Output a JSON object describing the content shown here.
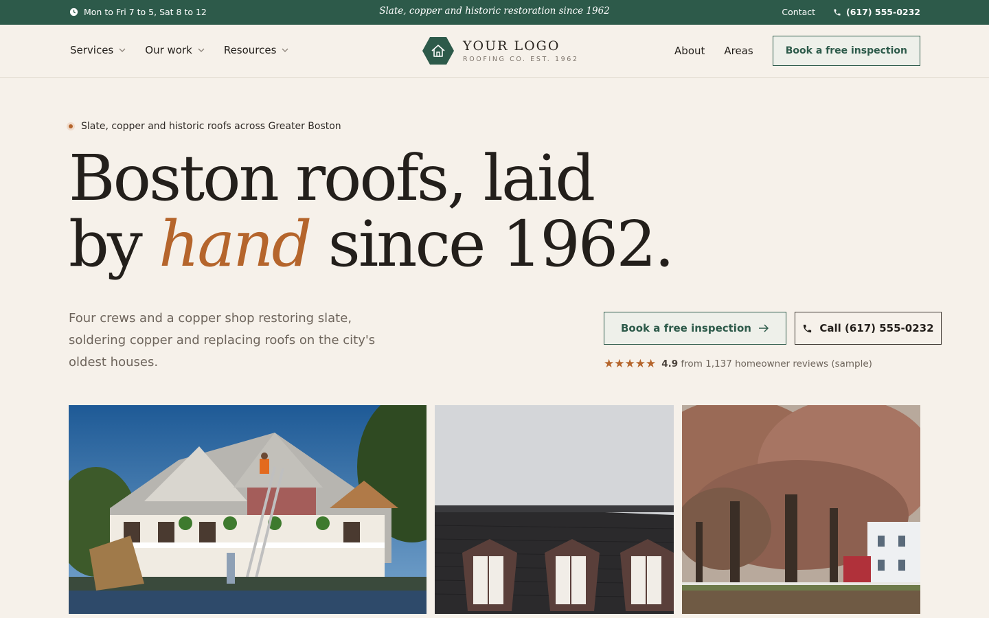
{
  "topbar": {
    "hours": "Mon to Fri 7 to 5, Sat 8 to 12",
    "tagline": "Slate, copper and historic restoration since 1962",
    "contact": "Contact",
    "phone": "(617) 555-0232",
    "background_color": "#2d5a4a"
  },
  "header": {
    "nav_left": [
      "Services",
      "Our work",
      "Resources"
    ],
    "logo_title": "YOUR LOGO",
    "logo_subtitle": "ROOFING CO. EST. 1962",
    "nav_right": [
      "About",
      "Areas"
    ],
    "cta": "Book a free inspection"
  },
  "hero": {
    "eyebrow": "Slate, copper and historic roofs across Greater Boston",
    "headline_part1": "Boston roofs, laid",
    "headline_part2": "by",
    "headline_accent": "hand",
    "headline_part3": "since 1962.",
    "lede": "Four crews and a copper shop restoring slate, soldering copper and replacing roofs on the city's oldest houses.",
    "primary_cta": "Book a free inspection",
    "secondary_cta": "Call (617) 555-0232",
    "rating_value": "4.9",
    "rating_text": "from 1,137 homeowner reviews (sample)",
    "stars": "★★★★★"
  },
  "colors": {
    "accent": "#b5652c",
    "brand_green": "#2d5a4a",
    "background": "#f6f1ea"
  },
  "photos": [
    {
      "alt": "crew-reroofing-victorian-house"
    },
    {
      "alt": "slate-mansard-roof-dormers"
    },
    {
      "alt": "autumn-trees-colonial-house"
    }
  ]
}
